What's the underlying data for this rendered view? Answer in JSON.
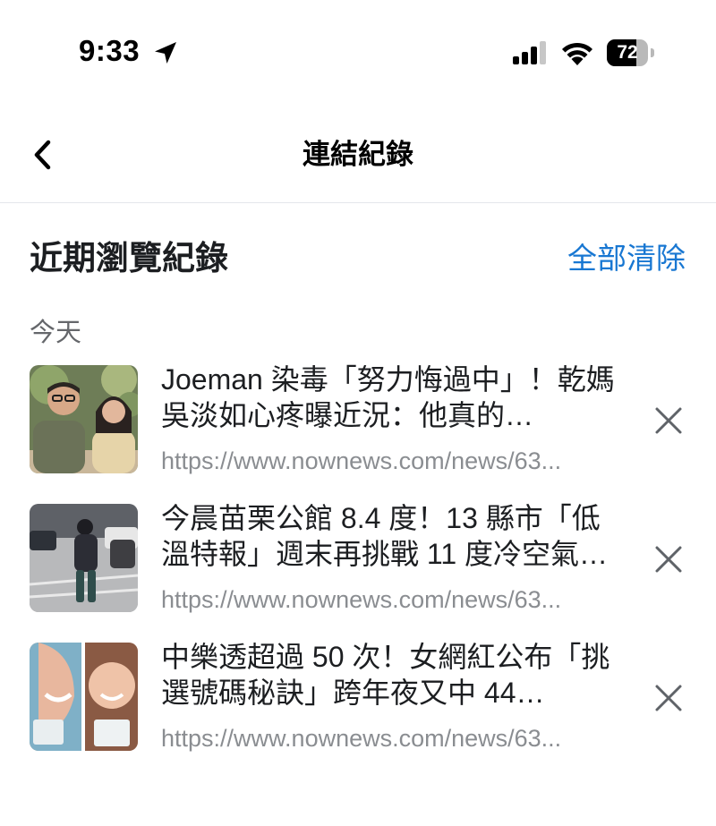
{
  "status_bar": {
    "time": "9:33",
    "battery_percent": "72",
    "battery_level": 0.72,
    "icons": [
      "location-arrow-icon",
      "cellular-signal-icon",
      "wifi-icon",
      "battery-icon"
    ]
  },
  "nav": {
    "back_icon": "chevron-left-icon",
    "title": "連結紀錄"
  },
  "section": {
    "title": "近期瀏覽紀錄",
    "clear_all_label": "全部清除",
    "date_label": "今天"
  },
  "history": [
    {
      "title": "Joeman 染毒「努力悔過中」！乾媽吳淡如心疼曝近況：他真的…",
      "url": "https://www.nownews.com/news/63...",
      "remove_icon": "close-icon"
    },
    {
      "title": "今晨苗栗公館 8.4 度！13 縣市「低溫特報」週末再挑戰 11 度冷空氣…",
      "url": "https://www.nownews.com/news/63...",
      "remove_icon": "close-icon"
    },
    {
      "title": "中樂透超過 50 次！女網紅公布「挑選號碼秘訣」跨年夜又中 44…",
      "url": "https://www.nownews.com/news/63...",
      "remove_icon": "close-icon"
    }
  ],
  "colors": {
    "accent": "#1877d2",
    "secondary_text": "#65676b",
    "url_text": "#8a8d91"
  }
}
